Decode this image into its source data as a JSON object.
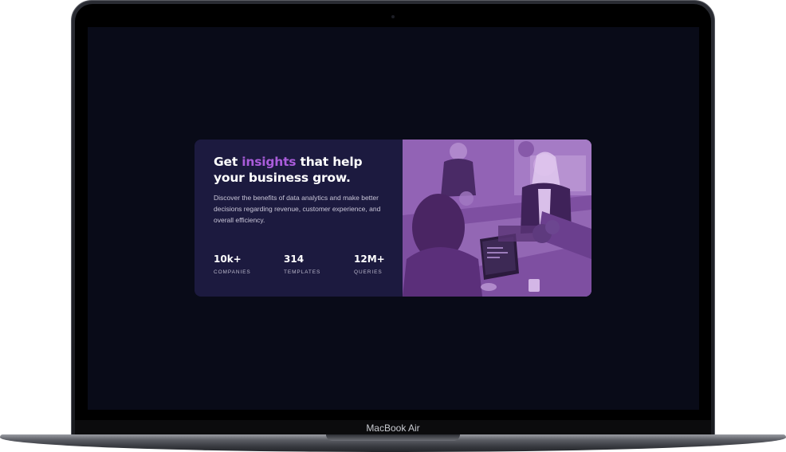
{
  "device": {
    "label": "MacBook Air"
  },
  "card": {
    "headline_pre": "Get ",
    "headline_accent": "insights",
    "headline_post": " that help your business grow.",
    "description": "Discover the benefits of data analytics and make better decisions regarding revenue, customer experience, and overall efficiency.",
    "stats": [
      {
        "value": "10k+",
        "label": "COMPANIES"
      },
      {
        "value": "314",
        "label": "TEMPLATES"
      },
      {
        "value": "12M+",
        "label": "QUERIES"
      }
    ]
  },
  "colors": {
    "screen_bg": "#090b18",
    "card_bg": "#1c1a3f",
    "accent": "#aa5cdb",
    "photo_tint": "#8d5bae"
  },
  "image": {
    "subject": "women-working-at-laptops-photo"
  }
}
